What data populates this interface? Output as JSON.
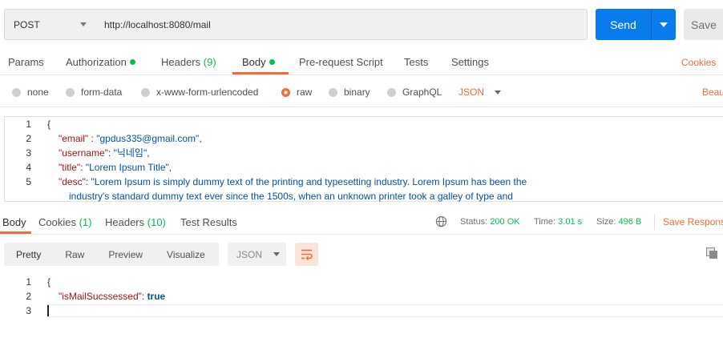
{
  "request": {
    "method": "POST",
    "url": "http://localhost:8080/mail",
    "send_label": "Send",
    "save_label": "Save"
  },
  "request_tabs": {
    "params": "Params",
    "authorization": "Authorization",
    "headers": "Headers",
    "headers_count": "(9)",
    "body": "Body",
    "prerequest": "Pre-request Script",
    "tests": "Tests",
    "settings": "Settings",
    "cookies": "Cookies"
  },
  "body_types": {
    "none": "none",
    "form_data": "form-data",
    "urlencoded": "x-www-form-urlencoded",
    "raw": "raw",
    "binary": "binary",
    "graphql": "GraphQL",
    "format": "JSON",
    "beautify": "Beau"
  },
  "request_body": {
    "line_numbers": [
      "1",
      "2",
      "3",
      "4",
      "5"
    ],
    "open_brace": "{",
    "lines": [
      {
        "key": "\"email\"",
        "sep": " : ",
        "value": "\"gpdus335@gmail.com\"",
        "end": ","
      },
      {
        "key": "\"username\"",
        "sep": ": ",
        "value": "\"닉네임\"",
        "end": ","
      },
      {
        "key": "\"title\"",
        "sep": ": ",
        "value": "\"Lorem Ipsum Title\"",
        "end": ","
      },
      {
        "key": "\"desc\"",
        "sep": ": ",
        "value": "\"Lorem Ipsum is simply dummy text of the printing and typesetting industry. Lorem Ipsum has been the",
        "end": ""
      }
    ],
    "wrap_line": "industry's standard dummy text ever since the 1500s, when an unknown printer took a galley of type and"
  },
  "response_tabs": {
    "body": "Body",
    "cookies": "Cookies",
    "cookies_count": "(1)",
    "headers": "Headers",
    "headers_count": "(10)",
    "test_results": "Test Results"
  },
  "response_meta": {
    "status_label": "Status:",
    "status_value": "200 OK",
    "time_label": "Time:",
    "time_value": "3.01 s",
    "size_label": "Size:",
    "size_value": "496 B",
    "save_response": "Save Respons"
  },
  "view_modes": {
    "pretty": "Pretty",
    "raw": "Raw",
    "preview": "Preview",
    "visualize": "Visualize",
    "format": "JSON"
  },
  "response_body": {
    "line_numbers": [
      "1",
      "2",
      "3"
    ],
    "open_brace": "{",
    "key": "\"isMailSucssessed\"",
    "sep": ": ",
    "value": "true"
  },
  "colors": {
    "accent": "#f26b3a",
    "send_button": "#097bed",
    "success": "#0cbb52"
  }
}
